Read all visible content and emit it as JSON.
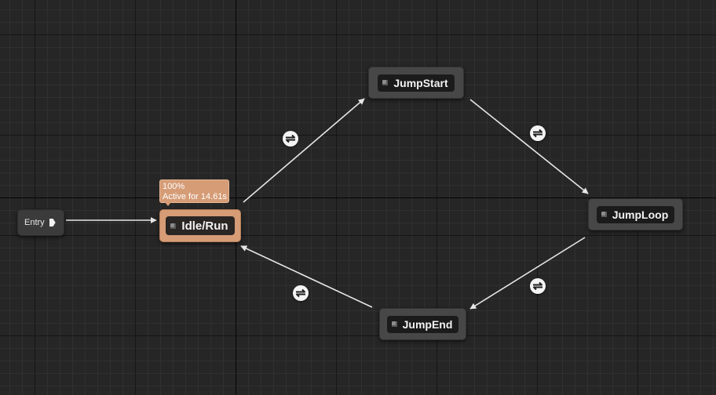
{
  "graph": {
    "entry": {
      "label": "Entry"
    },
    "states": [
      {
        "id": "idle-run",
        "label": "Idle/Run",
        "active": true
      },
      {
        "id": "jumpstart",
        "label": "JumpStart",
        "active": false
      },
      {
        "id": "jumploop",
        "label": "JumpLoop",
        "active": false
      },
      {
        "id": "jumpend",
        "label": "JumpEnd",
        "active": false
      }
    ],
    "active_info": {
      "weight": "100%",
      "active_text": "Active for 14.61s"
    },
    "transitions": [
      {
        "from": "Idle/Run",
        "to": "JumpStart"
      },
      {
        "from": "JumpStart",
        "to": "JumpLoop"
      },
      {
        "from": "JumpLoop",
        "to": "JumpEnd"
      },
      {
        "from": "JumpEnd",
        "to": "Idle/Run"
      }
    ]
  },
  "colors": {
    "background": "#262626",
    "active_state": "#d59c76",
    "state_node": "#474747",
    "wire": "#e6e6e6"
  },
  "icons": {
    "entry_pin": "exec-pin-icon",
    "state": "state-node-icon",
    "transition": "transition-rule-icon"
  }
}
